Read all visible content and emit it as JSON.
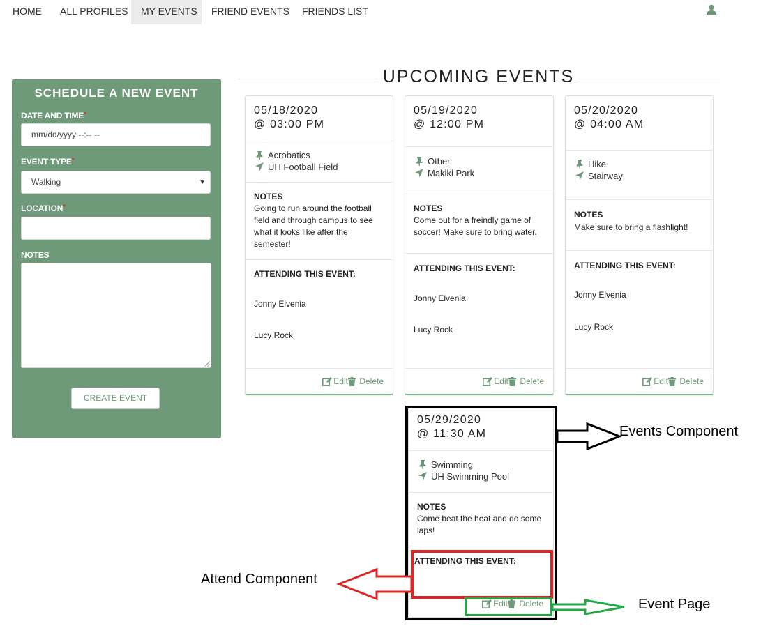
{
  "nav": {
    "items": [
      "HOME",
      "ALL PROFILES",
      "MY EVENTS",
      "FRIEND EVENTS",
      "FRIENDS LIST"
    ],
    "active": "MY EVENTS",
    "user_icon": "user-icon"
  },
  "form": {
    "title": "SCHEDULE A NEW EVENT",
    "date_label": "DATE AND TIME",
    "date_placeholder": "mm/dd/yyyy --:-- --",
    "type_label": "EVENT TYPE",
    "type_value": "Walking",
    "location_label": "LOCATION",
    "location_value": "",
    "notes_label": "NOTES",
    "notes_value": "",
    "required_mark": "*",
    "submit_label": "CREATE EVENT"
  },
  "section_title": "UPCOMING EVENTS",
  "labels": {
    "notes": "NOTES",
    "attending": "ATTENDING THIS EVENT:",
    "edit": "Edit",
    "delete": "Delete"
  },
  "events": [
    {
      "date": "05/18/2020",
      "time": "@ 03:00 PM",
      "type": "Acrobatics",
      "location": "UH Football Field",
      "notes_lines": [
        "Going to run around the football",
        "field and through campus to see",
        "what it looks like after the",
        "semester!"
      ],
      "attendees": [
        "Jonny Elvenia",
        "Lucy Rock"
      ]
    },
    {
      "date": "05/19/2020",
      "time": "@ 12:00 PM",
      "type": "Other",
      "location": "Makiki Park",
      "notes_lines": [
        "Come out for a freindly game of",
        "soccer! Make sure to bring water."
      ],
      "attendees": [
        "Jonny Elvenia",
        "Lucy Rock"
      ]
    },
    {
      "date": "05/20/2020",
      "time": "@ 04:00 AM",
      "type": "Hike",
      "location": "Stairway",
      "notes_lines": [
        "Make sure to bring a flashlight!"
      ],
      "attendees": [
        "Jonny Elvenia",
        "Lucy Rock"
      ]
    },
    {
      "date": "05/29/2020",
      "time": "@ 11:30 AM",
      "type": "Swimming",
      "location": "UH Swimming Pool",
      "notes_lines": [
        "Come beat the heat and do some",
        "laps!"
      ],
      "attendees": []
    }
  ],
  "annotations": {
    "events_component": "Events Component",
    "attend_component": "Attend Component",
    "event_page": "Event Page",
    "colors": {
      "events": "#000000",
      "attend": "#e02424",
      "event_page": "#22a845"
    }
  },
  "colors": {
    "accent": "#6e9a79",
    "card_border_accent": "#79b98a"
  }
}
